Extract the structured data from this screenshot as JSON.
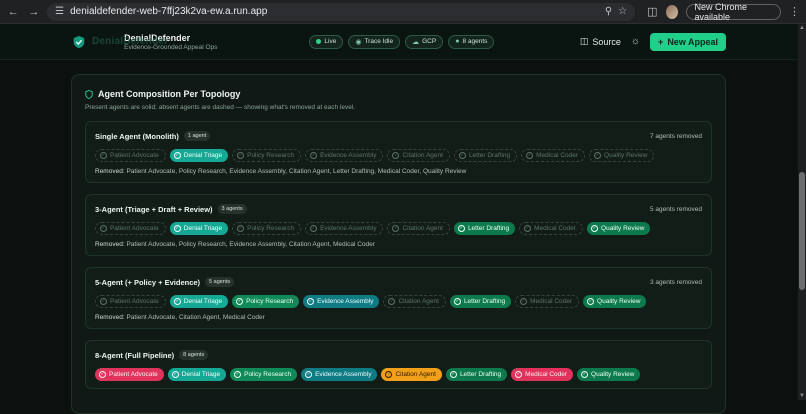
{
  "browser": {
    "url": "denialdefender-web-7ffj23k2va-ew.a.run.app",
    "new_chrome_label": "New Chrome available"
  },
  "header": {
    "logo_ghost": "DenialDefender",
    "title": "DenialDefender",
    "subtitle": "Evidence-Grounded Appeal Ops",
    "pills": [
      "Live",
      "Trace Idle",
      "GCP",
      "8 agents"
    ],
    "source_label": "Source",
    "new_appeal_label": "New Appeal"
  },
  "panel": {
    "title": "Agent Composition Per Topology",
    "description": "Present agents are solid; absent agents are dashed — showing what's removed at each level."
  },
  "topologies": [
    {
      "name": "Single Agent (Monolith)",
      "badge": "1 agent",
      "removed_count": "7 agents removed",
      "removed_label": "Removed:",
      "removed_text": "Patient Advocate, Policy Research, Evidence Assembly, Citation Agent, Letter Drafting, Medical Coder, Quality Review",
      "chips": [
        {
          "label": "Patient Advocate",
          "present": false
        },
        {
          "label": "Denial Triage",
          "present": true
        },
        {
          "label": "Policy Research",
          "present": false
        },
        {
          "label": "Evidence Assembly",
          "present": false
        },
        {
          "label": "Citation Agent",
          "present": false
        },
        {
          "label": "Letter Drafting",
          "present": false
        },
        {
          "label": "Medical Coder",
          "present": false
        },
        {
          "label": "Quality Review",
          "present": false
        }
      ]
    },
    {
      "name": "3-Agent (Triage + Draft + Review)",
      "badge": "3 agents",
      "removed_count": "5 agents removed",
      "removed_label": "Removed:",
      "removed_text": "Patient Advocate, Policy Research, Evidence Assembly, Citation Agent, Medical Coder",
      "chips": [
        {
          "label": "Patient Advocate",
          "present": false
        },
        {
          "label": "Denial Triage",
          "present": true
        },
        {
          "label": "Policy Research",
          "present": false
        },
        {
          "label": "Evidence Assembly",
          "present": false
        },
        {
          "label": "Citation Agent",
          "present": false
        },
        {
          "label": "Letter Drafting",
          "present": true
        },
        {
          "label": "Medical Coder",
          "present": false
        },
        {
          "label": "Quality Review",
          "present": true
        }
      ]
    },
    {
      "name": "5-Agent (+ Policy + Evidence)",
      "badge": "5 agents",
      "removed_count": "3 agents removed",
      "removed_label": "Removed:",
      "removed_text": "Patient Advocate, Citation Agent, Medical Coder",
      "chips": [
        {
          "label": "Patient Advocate",
          "present": false
        },
        {
          "label": "Denial Triage",
          "present": true
        },
        {
          "label": "Policy Research",
          "present": true
        },
        {
          "label": "Evidence Assembly",
          "present": true
        },
        {
          "label": "Citation Agent",
          "present": false
        },
        {
          "label": "Letter Drafting",
          "present": true
        },
        {
          "label": "Medical Coder",
          "present": false
        },
        {
          "label": "Quality Review",
          "present": true
        }
      ]
    },
    {
      "name": "8-Agent (Full Pipeline)",
      "badge": "8 agents",
      "removed_count": "",
      "removed_label": "",
      "removed_text": "",
      "chips": [
        {
          "label": "Patient Advocate",
          "present": true
        },
        {
          "label": "Denial Triage",
          "present": true
        },
        {
          "label": "Policy Research",
          "present": true
        },
        {
          "label": "Evidence Assembly",
          "present": true
        },
        {
          "label": "Citation Agent",
          "present": true
        },
        {
          "label": "Letter Drafting",
          "present": true
        },
        {
          "label": "Medical Coder",
          "present": true
        },
        {
          "label": "Quality Review",
          "present": true
        }
      ]
    }
  ],
  "colors": {
    "accent": "#1fcf8a",
    "patient_advocate": "#e0335b",
    "denial_triage": "#15a895",
    "policy_research": "#0f8a58",
    "evidence_assembly": "#0f7c84",
    "citation_agent": "#f2a01a",
    "letter_drafting": "#0d7a4e",
    "medical_coder": "#e0335b",
    "quality_review": "#0d7a4e"
  }
}
